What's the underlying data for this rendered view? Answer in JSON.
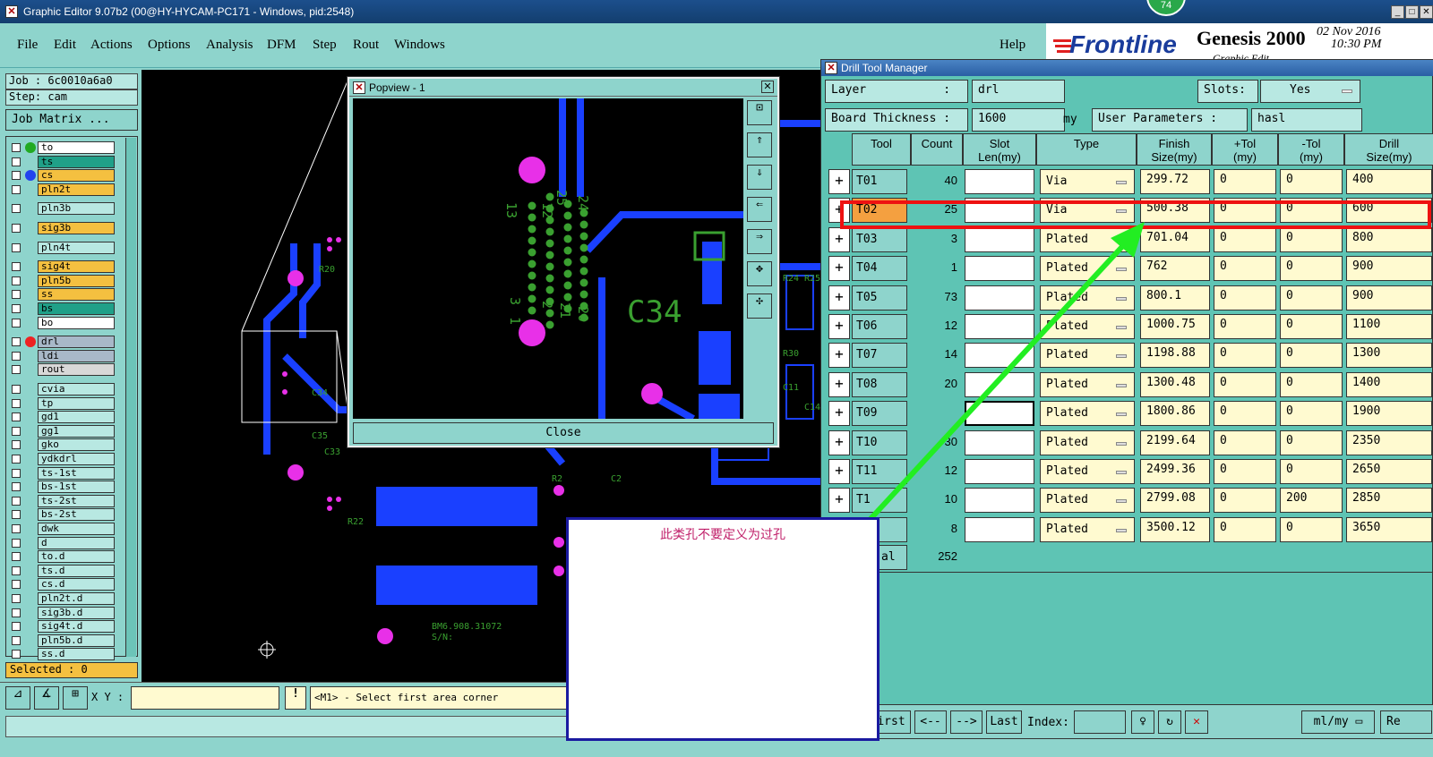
{
  "window": {
    "title": "Graphic Editor 9.07b2 (00@HY-HYCAM-PC171 - Windows, pid:2548)",
    "badge": "74"
  },
  "menu": [
    "File",
    "Edit",
    "Actions",
    "Options",
    "Analysis",
    "DFM",
    "Step",
    "Rout",
    "Windows"
  ],
  "help_label": "Help",
  "logo": {
    "brand": "Frontline",
    "product": "Genesis 2000",
    "date": "02 Nov 2016",
    "time": "10:30 PM",
    "sub": "Graphic Edit"
  },
  "left": {
    "job": "Job : 6c0010a6a0",
    "step": "Step: cam",
    "job_matrix": "Job Matrix ...",
    "selected": "Selected : 0",
    "layers": [
      {
        "name": "to",
        "color": "#ffffff",
        "dot": "#22aa22"
      },
      {
        "name": "ts",
        "color": "#20a088",
        "dot": ""
      },
      {
        "name": "cs",
        "color": "#f4c040",
        "dot": "#2244ee"
      },
      {
        "name": "pln2t",
        "color": "#f4c040",
        "dot": ""
      },
      {
        "name": "pln3b",
        "color": "#b8e8e2",
        "dot": ""
      },
      {
        "name": "sig3b",
        "color": "#f4c040",
        "dot": ""
      },
      {
        "name": "pln4t",
        "color": "#b8e8e2",
        "dot": ""
      },
      {
        "name": "sig4t",
        "color": "#f4c040",
        "dot": ""
      },
      {
        "name": "pln5b",
        "color": "#f4c040",
        "dot": ""
      },
      {
        "name": "ss",
        "color": "#f4c040",
        "dot": ""
      },
      {
        "name": "bs",
        "color": "#20a088",
        "dot": ""
      },
      {
        "name": "bo",
        "color": "#ffffff",
        "dot": ""
      },
      {
        "name": "drl",
        "color": "#a8b8c8",
        "dot": "#ee2222"
      },
      {
        "name": "ldi",
        "color": "#a8b8c8",
        "dot": ""
      },
      {
        "name": "rout",
        "color": "#d8d8d8",
        "dot": ""
      },
      {
        "name": "cvia",
        "color": "#b8e8e2",
        "dot": ""
      },
      {
        "name": "tp",
        "color": "#b8e8e2",
        "dot": ""
      },
      {
        "name": "gd1",
        "color": "#b8e8e2",
        "dot": ""
      },
      {
        "name": "gg1",
        "color": "#b8e8e2",
        "dot": ""
      },
      {
        "name": "gko",
        "color": "#b8e8e2",
        "dot": ""
      },
      {
        "name": "ydkdrl",
        "color": "#b8e8e2",
        "dot": ""
      },
      {
        "name": "ts-1st",
        "color": "#b8e8e2",
        "dot": ""
      },
      {
        "name": "bs-1st",
        "color": "#b8e8e2",
        "dot": ""
      },
      {
        "name": "ts-2st",
        "color": "#b8e8e2",
        "dot": ""
      },
      {
        "name": "bs-2st",
        "color": "#b8e8e2",
        "dot": ""
      },
      {
        "name": "dwk",
        "color": "#b8e8e2",
        "dot": ""
      },
      {
        "name": "d",
        "color": "#b8e8e2",
        "dot": ""
      },
      {
        "name": "to.d",
        "color": "#b8e8e2",
        "dot": ""
      },
      {
        "name": "ts.d",
        "color": "#b8e8e2",
        "dot": ""
      },
      {
        "name": "cs.d",
        "color": "#b8e8e2",
        "dot": ""
      },
      {
        "name": "pln2t.d",
        "color": "#b8e8e2",
        "dot": ""
      },
      {
        "name": "sig3b.d",
        "color": "#b8e8e2",
        "dot": ""
      },
      {
        "name": "sig4t.d",
        "color": "#b8e8e2",
        "dot": ""
      },
      {
        "name": "pln5b.d",
        "color": "#b8e8e2",
        "dot": ""
      },
      {
        "name": "ss.d",
        "color": "#b8e8e2",
        "dot": ""
      }
    ]
  },
  "status": {
    "xy_label": "X Y :",
    "message": "<M1> - Select first area corner"
  },
  "popview": {
    "title": "Popview - 1",
    "close": "Close",
    "component": "C34",
    "pins": [
      "13",
      "12",
      "25",
      "24",
      "3",
      "1",
      "2",
      "21",
      "20"
    ]
  },
  "board": {
    "refs": [
      "R20",
      "C34",
      "C35",
      "C33",
      "R22",
      "R24",
      "R25",
      "R30",
      "C14",
      "C11",
      "C2",
      "R2"
    ],
    "text1": "BM6.908.31072",
    "text2": "S/N:"
  },
  "dtm": {
    "title": "Drill Tool Manager",
    "layer_label": "Layer           :",
    "layer_value": "drl",
    "slots_label": "Slots:",
    "slots_value": "Yes",
    "thickness_label": "Board Thickness :",
    "thickness_value": "1600",
    "thickness_unit": "my",
    "user_params_label": "User Parameters :",
    "user_params_value": "hasl",
    "headers": [
      "Tool",
      "Count",
      "Slot\nLen(my)",
      "Type",
      "Finish\nSize(my)",
      "+Tol\n(my)",
      "-Tol\n(my)",
      "Drill\nSize(my)"
    ],
    "rows": [
      {
        "tool": "T01",
        "count": "40",
        "type": "Via",
        "finish": "299.72",
        "ptol": "0",
        "mtol": "0",
        "drill": "400"
      },
      {
        "tool": "T02",
        "count": "25",
        "type": "Via",
        "finish": "500.38",
        "ptol": "0",
        "mtol": "0",
        "drill": "600"
      },
      {
        "tool": "T03",
        "count": "3",
        "type": "Plated",
        "finish": "701.04",
        "ptol": "0",
        "mtol": "0",
        "drill": "800"
      },
      {
        "tool": "T04",
        "count": "1",
        "type": "Plated",
        "finish": "762",
        "ptol": "0",
        "mtol": "0",
        "drill": "900"
      },
      {
        "tool": "T05",
        "count": "73",
        "type": "Plated",
        "finish": "800.1",
        "ptol": "0",
        "mtol": "0",
        "drill": "900"
      },
      {
        "tool": "T06",
        "count": "12",
        "type": "Plated",
        "finish": "1000.75",
        "ptol": "0",
        "mtol": "0",
        "drill": "1100"
      },
      {
        "tool": "T07",
        "count": "14",
        "type": "Plated",
        "finish": "1198.88",
        "ptol": "0",
        "mtol": "0",
        "drill": "1300"
      },
      {
        "tool": "T08",
        "count": "20",
        "type": "Plated",
        "finish": "1300.48",
        "ptol": "0",
        "mtol": "0",
        "drill": "1400"
      },
      {
        "tool": "T09",
        "count": "",
        "type": "Plated",
        "finish": "1800.86",
        "ptol": "0",
        "mtol": "0",
        "drill": "1900"
      },
      {
        "tool": "T10",
        "count": "30",
        "type": "Plated",
        "finish": "2199.64",
        "ptol": "0",
        "mtol": "0",
        "drill": "2350"
      },
      {
        "tool": "T11",
        "count": "12",
        "type": "Plated",
        "finish": "2499.36",
        "ptol": "0",
        "mtol": "0",
        "drill": "2650"
      },
      {
        "tool": "T1",
        "count": "10",
        "type": "Plated",
        "finish": "2799.08",
        "ptol": "0",
        "mtol": "200",
        "drill": "2850"
      },
      {
        "tool": "",
        "count": "8",
        "type": "Plated",
        "finish": "3500.12",
        "ptol": "0",
        "mtol": "0",
        "drill": "3650"
      }
    ],
    "total_label": "al",
    "total_count": "252",
    "nav": {
      "first": "irst",
      "prev": "<--",
      "next": "-->",
      "last": "Last",
      "index": "Index:",
      "units": "ml/my",
      "re": "Re"
    }
  },
  "annotation": {
    "text": "此类孔不要定义为过孔",
    "color": "#c0206a",
    "highlight_color": "#ee1111",
    "arrow_color": "#22ee22"
  }
}
